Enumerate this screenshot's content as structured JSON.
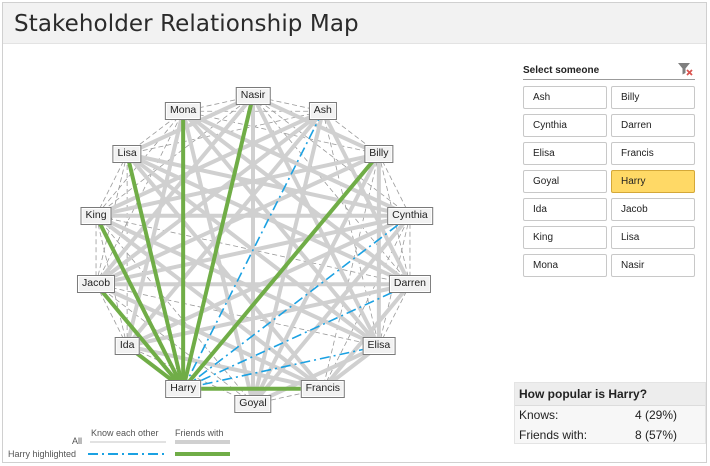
{
  "title": "Stakeholder Relationship Map",
  "colors": {
    "know": "#d9d9d9",
    "friends": "#d0d0d0",
    "highlight_friends": "#70ad47",
    "highlight_know": "#1ba1e2",
    "dashed": "#9a9a9a",
    "selected": "#ffd966"
  },
  "people": [
    "Nasir",
    "Ash",
    "Billy",
    "Cynthia",
    "Darren",
    "Elisa",
    "Francis",
    "Goyal",
    "Harry",
    "Ida",
    "Jacob",
    "King",
    "Lisa",
    "Mona"
  ],
  "selected_person": "Harry",
  "friends_edges": [
    [
      "Harry",
      "Nasir"
    ],
    [
      "Harry",
      "Mona"
    ],
    [
      "Harry",
      "Lisa"
    ],
    [
      "Harry",
      "King"
    ],
    [
      "Harry",
      "Jacob"
    ],
    [
      "Harry",
      "Ida"
    ],
    [
      "Harry",
      "Billy"
    ],
    [
      "Harry",
      "Francis"
    ],
    [
      "Nasir",
      "Billy"
    ],
    [
      "Nasir",
      "Lisa"
    ],
    [
      "Nasir",
      "Jacob"
    ],
    [
      "Nasir",
      "Goyal"
    ],
    [
      "Nasir",
      "Elisa"
    ],
    [
      "Mona",
      "Ida"
    ],
    [
      "Mona",
      "Elisa"
    ],
    [
      "Mona",
      "Darren"
    ],
    [
      "Lisa",
      "Darren"
    ],
    [
      "Lisa",
      "Francis"
    ],
    [
      "Lisa",
      "Cynthia"
    ],
    [
      "King",
      "Cynthia"
    ],
    [
      "King",
      "Elisa"
    ],
    [
      "King",
      "Billy"
    ],
    [
      "Ash",
      "Goyal"
    ],
    [
      "Ash",
      "Ida"
    ],
    [
      "Ash",
      "Darren"
    ],
    [
      "Billy",
      "Jacob"
    ],
    [
      "Billy",
      "Goyal"
    ],
    [
      "Billy",
      "Elisa"
    ],
    [
      "Cynthia",
      "Jacob"
    ],
    [
      "Cynthia",
      "Ida"
    ],
    [
      "Cynthia",
      "Goyal"
    ],
    [
      "Jacob",
      "Darren"
    ],
    [
      "Jacob",
      "Francis"
    ],
    [
      "Ida",
      "Darren"
    ],
    [
      "Ida",
      "Francis"
    ],
    [
      "Goyal",
      "Elisa"
    ],
    [
      "Goyal",
      "Mona"
    ],
    [
      "Darren",
      "Francis"
    ],
    [
      "Elisa",
      "Francis"
    ],
    [
      "King",
      "Francis"
    ],
    [
      "Mona",
      "Cynthia"
    ],
    [
      "Lisa",
      "Elisa"
    ],
    [
      "Ash",
      "King"
    ],
    [
      "Ash",
      "Jacob"
    ]
  ],
  "know_edges": [
    [
      "Harry",
      "Ash"
    ],
    [
      "Harry",
      "Cynthia"
    ],
    [
      "Harry",
      "Darren"
    ],
    [
      "Harry",
      "Elisa"
    ],
    [
      "Nasir",
      "Ash"
    ],
    [
      "Ash",
      "Billy"
    ],
    [
      "Billy",
      "Cynthia"
    ],
    [
      "Cynthia",
      "Darren"
    ],
    [
      "Darren",
      "Elisa"
    ],
    [
      "Elisa",
      "Goyal"
    ],
    [
      "Goyal",
      "Ida"
    ],
    [
      "Ida",
      "Jacob"
    ],
    [
      "Jacob",
      "King"
    ],
    [
      "King",
      "Lisa"
    ],
    [
      "Lisa",
      "Mona"
    ],
    [
      "Mona",
      "Nasir"
    ],
    [
      "Mona",
      "Ash"
    ],
    [
      "Lisa",
      "Ash"
    ],
    [
      "Mona",
      "Billy"
    ],
    [
      "King",
      "Nasir"
    ],
    [
      "Jacob",
      "Mona"
    ],
    [
      "Ida",
      "Lisa"
    ],
    [
      "Ida",
      "King"
    ],
    [
      "Goyal",
      "Jacob"
    ],
    [
      "Francis",
      "Goyal"
    ],
    [
      "Francis",
      "Cynthia"
    ],
    [
      "Darren",
      "Billy"
    ],
    [
      "Elisa",
      "Cynthia"
    ],
    [
      "Nasir",
      "Cynthia"
    ],
    [
      "Nasir",
      "Darren"
    ],
    [
      "Ash",
      "Elisa"
    ],
    [
      "Billy",
      "Francis"
    ],
    [
      "Mona",
      "King"
    ],
    [
      "Lisa",
      "Jacob"
    ],
    [
      "King",
      "Goyal"
    ],
    [
      "Jacob",
      "Elisa"
    ],
    [
      "Darren",
      "King"
    ],
    [
      "Cynthia",
      "Lisa"
    ]
  ],
  "slicer": {
    "title": "Select someone",
    "items": [
      {
        "label": "Ash"
      },
      {
        "label": "Billy"
      },
      {
        "label": "Cynthia"
      },
      {
        "label": "Darren"
      },
      {
        "label": "Elisa"
      },
      {
        "label": "Francis"
      },
      {
        "label": "Goyal"
      },
      {
        "label": "Harry",
        "selected": true
      },
      {
        "label": "Ida"
      },
      {
        "label": "Jacob"
      },
      {
        "label": "King"
      },
      {
        "label": "Lisa"
      },
      {
        "label": "Mona"
      },
      {
        "label": "Nasir"
      }
    ]
  },
  "stats": {
    "title": "How popular is Harry?",
    "knows_label": "Knows:",
    "knows_value": "4 (29%)",
    "friends_label": "Friends with:",
    "friends_value": "8 (57%)"
  },
  "legend": {
    "col1": "Know each other",
    "col2": "Friends with",
    "row1": "All",
    "row2": "Harry highlighted"
  }
}
